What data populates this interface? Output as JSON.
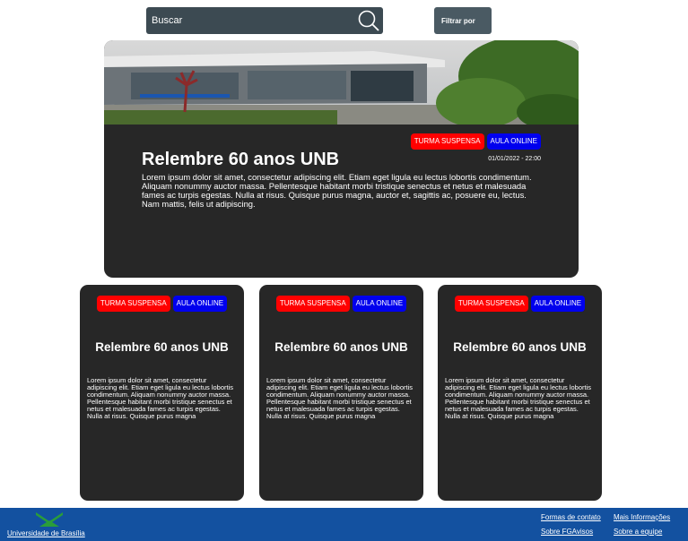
{
  "search": {
    "placeholder": "Buscar"
  },
  "filter": {
    "label": "Filtrar por"
  },
  "hero": {
    "badges": [
      "TURMA SUSPENSA",
      "AULA ONLINE"
    ],
    "date": "01/01/2022 - 22:00",
    "title": "Relembre 60 anos UNB",
    "body": "Lorem ipsum dolor sit amet, consectetur adipiscing elit. Etiam eget ligula eu lectus lobortis condimentum. Aliquam nonummy auctor massa. Pellentesque habitant morbi tristique senectus et netus et malesuada fames ac turpis egestas. Nulla at risus. Quisque purus magna, auctor et, sagittis ac, posuere eu, lectus. Nam mattis, felis ut adipiscing."
  },
  "cards": [
    {
      "badges": [
        "TURMA SUSPENSA",
        "AULA ONLINE"
      ],
      "title": "Relembre 60 anos UNB",
      "body": "Lorem ipsum dolor sit amet, consectetur adipiscing elit. Etiam eget ligula eu lectus lobortis condimentum. Aliquam nonummy auctor massa. Pellentesque habitant morbi tristique senectus et netus et malesuada fames ac turpis egestas. Nulla at risus. Quisque purus magna"
    },
    {
      "badges": [
        "TURMA SUSPENSA",
        "AULA ONLINE"
      ],
      "title": "Relembre 60 anos UNB",
      "body": "Lorem ipsum dolor sit amet, consectetur adipiscing elit. Etiam eget ligula eu lectus lobortis condimentum. Aliquam nonummy auctor massa. Pellentesque habitant morbi tristique senectus et netus et malesuada fames ac turpis egestas. Nulla at risus. Quisque purus magna"
    },
    {
      "badges": [
        "TURMA SUSPENSA",
        "AULA ONLINE"
      ],
      "title": "Relembre 60 anos UNB",
      "body": "Lorem ipsum dolor sit amet, consectetur adipiscing elit. Etiam eget ligula eu lectus lobortis condimentum. Aliquam nonummy auctor massa. Pellentesque habitant morbi tristique senectus et netus et malesuada fames ac turpis egestas. Nulla at risus. Quisque purus magna"
    }
  ],
  "footer": {
    "brand": "Universidade de Brasília",
    "links": [
      "Formas de contato",
      "Mais Informações",
      "Sobre FGAvisos",
      "Sobre a equipe"
    ]
  },
  "colors": {
    "badge_red": "#ff0000",
    "badge_blue": "#0000ee",
    "card_bg": "#272727",
    "footer_bg": "#1351a0",
    "search_bg": "#3c4a52"
  },
  "icons": [
    "search-icon",
    "campus-photo",
    "unb-logo"
  ]
}
